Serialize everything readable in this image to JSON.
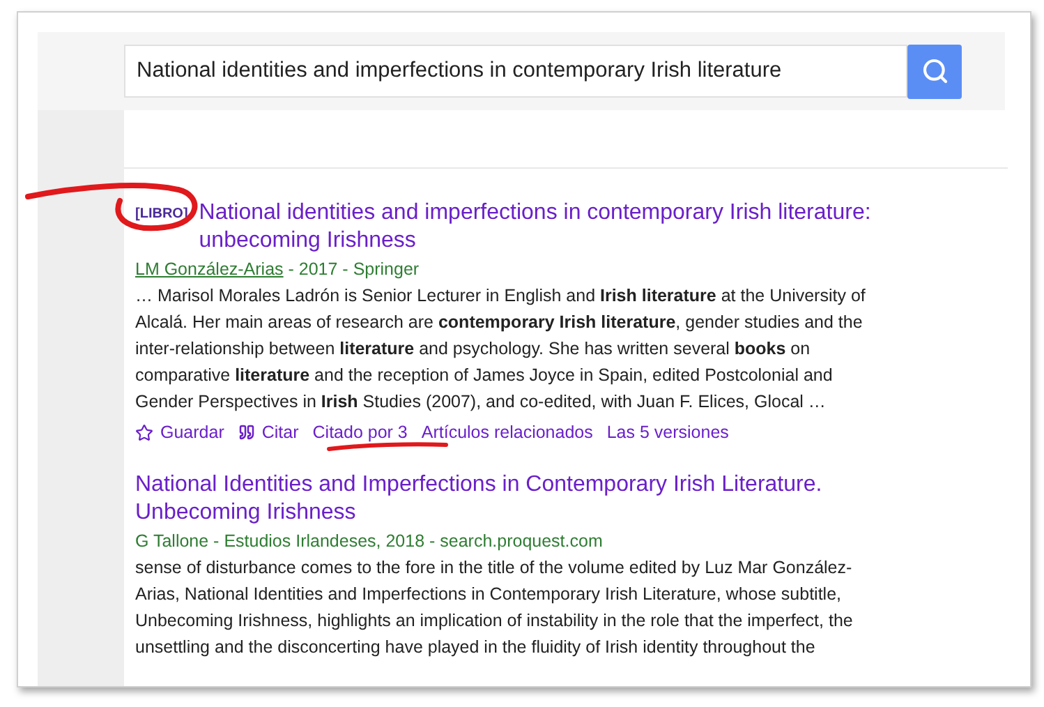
{
  "search": {
    "value": "National identities and imperfections in contemporary Irish literature"
  },
  "results": [
    {
      "tag": "[LIBRO]",
      "title": "National identities and imperfections in contemporary Irish literature: unbecoming Irishness",
      "author": "LM González-Arias",
      "source": " - 2017 - Springer",
      "snippet": "… Marisol Morales Ladrón is Senior Lecturer in English and **Irish literature** at the University of Alcalá. Her main areas of research are **contemporary Irish literature**, gender studies and the inter-relationship between **literature** and psychology. She has written several **books** on comparative **literature** and the reception of James Joyce in Spain, edited Postcolonial and Gender Perspectives in **Irish** Studies (2007), and co-edited, with Juan F. Elices, Glocal …",
      "actions": [
        {
          "kind": "save",
          "label": "Guardar"
        },
        {
          "kind": "cite",
          "label": "Citar"
        },
        {
          "kind": "link",
          "label": "Citado por 3"
        },
        {
          "kind": "link",
          "label": "Artículos relacionados"
        },
        {
          "kind": "link",
          "label": "Las 5 versiones"
        }
      ]
    },
    {
      "title": "National Identities and Imperfections in Contemporary Irish Literature. Unbecoming Irishness",
      "source": "G Tallone - Estudios Irlandeses, 2018 - search.proquest.com",
      "snippet": "sense of disturbance comes to the fore in the title of the volume edited by Luz Mar González-Arias, National Identities and Imperfections in Contemporary Irish Literature, whose subtitle, Unbecoming Irishness, highlights an implication of instability in the role that the imperfect, the unsettling and the disconcerting have played in the fluidity of Irish identity throughout the"
    }
  ]
}
